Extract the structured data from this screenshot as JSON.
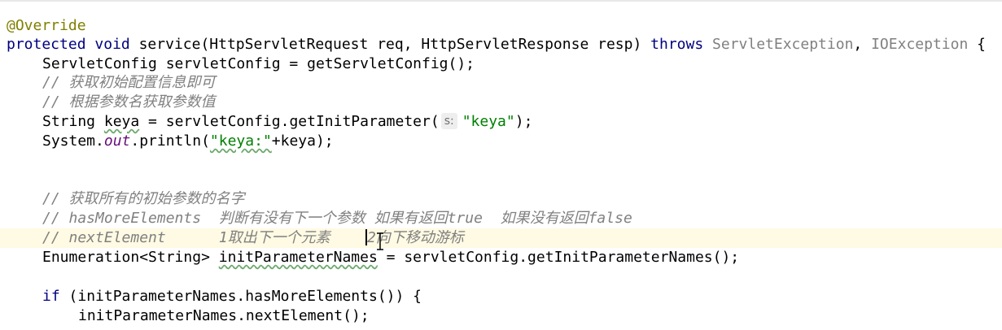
{
  "code": {
    "l1": {
      "annotation": "@Override"
    },
    "l2": {
      "kw_protected": "protected",
      "kw_void": "void",
      "method": "service",
      "params": "(HttpServletRequest req, HttpServletResponse resp) ",
      "kw_throws": "throws",
      "exc1": "ServletException",
      "comma": ", ",
      "exc2": "IOException",
      "brace": " {"
    },
    "l3": {
      "text": "ServletConfig servletConfig = getServletConfig();"
    },
    "l4": {
      "comment": "// 获取初始配置信息即可"
    },
    "l5": {
      "comment": "// 根据参数名获取参数值"
    },
    "l6": {
      "pre": "String ",
      "var": "keya",
      "mid": " = servletConfig.getInitParameter(",
      "hint": "s:",
      "str": "\"keya\"",
      "post": ");"
    },
    "l7": {
      "pre": "System.",
      "field": "out",
      "mid": ".println(",
      "str": "\"keya:\"",
      "post": "+keya);"
    },
    "l10": {
      "comment": "// 获取所有的初始参数的名字"
    },
    "l11": {
      "comment": "// hasMoreElements  判断有没有下一个参数 如果有返回true  如果没有返回false"
    },
    "l12": {
      "comment_a": "// nextElement      1取出下一个元素    ",
      "comment_b": "2向下移动游标"
    },
    "l13": {
      "pre": "Enumeration<String> ",
      "var": "initParameterNames",
      "post": " = servletConfig.getInitParameterNames();"
    },
    "l15": {
      "kw_if": "if",
      "text": " (initParameterNames.hasMoreElements()) {"
    },
    "l16": {
      "text": "initParameterNames.nextElement();"
    }
  },
  "colors": {
    "keyword": "#000080",
    "annotation": "#808000",
    "comment": "#808080",
    "string": "#008000",
    "static_field": "#660e7a",
    "current_line": "#fffae3"
  },
  "icons": {
    "mouse_cursor": "text-i-beam-cursor-icon"
  }
}
